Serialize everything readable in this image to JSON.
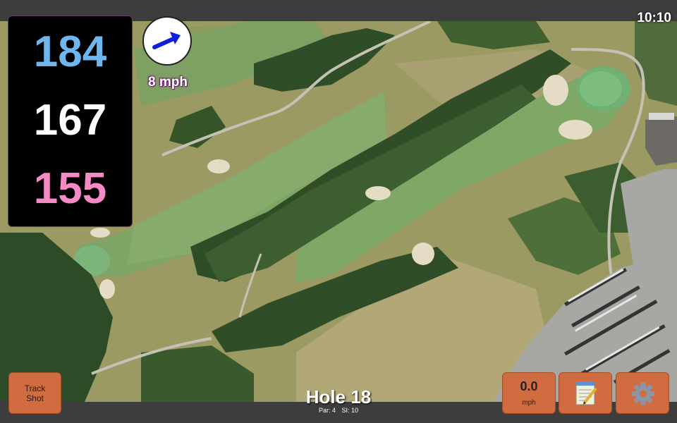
{
  "status_bar": {
    "clock": "10:10"
  },
  "distances": {
    "back": "184",
    "center": "167",
    "front": "155",
    "colors": {
      "back": "#6fb6ee",
      "center": "#ffffff",
      "front": "#f48ac6"
    }
  },
  "wind": {
    "speed_label": "8 mph",
    "direction_icon": "arrow-icon"
  },
  "hole": {
    "title": "Hole 18",
    "par": "Par: 4",
    "si": "SI: 10"
  },
  "buttons": {
    "track_shot_line1": "Track",
    "track_shot_line2": "Shot",
    "speed_value": "0.0",
    "speed_unit": "mph",
    "notes_icon": "notepad-icon",
    "settings_icon": "gear-icon",
    "accent": "#d06c3f"
  }
}
